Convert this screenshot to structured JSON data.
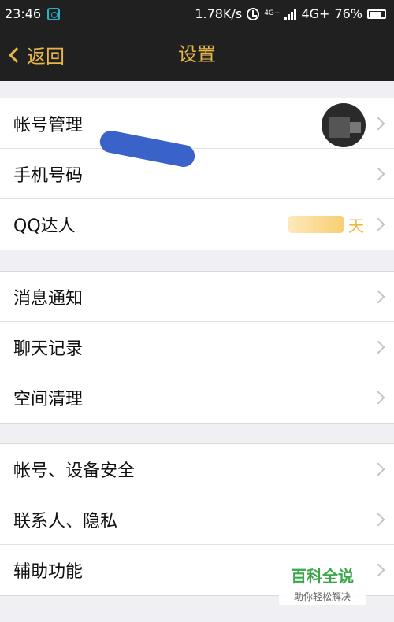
{
  "status_bar": {
    "time": "23:46",
    "speed": "1.78K/s",
    "net_small": "4G+",
    "network": "4G+",
    "battery": "76%",
    "icons": [
      "sim-icon",
      "alarm-icon",
      "signal-icon",
      "battery-icon"
    ]
  },
  "nav": {
    "back_label": "返回",
    "title": "设置"
  },
  "groups": [
    [
      {
        "label": "帐号管理"
      },
      {
        "label": "手机号码"
      },
      {
        "label": "QQ达人",
        "value_suffix": "天"
      }
    ],
    [
      {
        "label": "消息通知"
      },
      {
        "label": "聊天记录"
      },
      {
        "label": "空间清理"
      }
    ],
    [
      {
        "label": "帐号、设备安全"
      },
      {
        "label": "联系人、隐私"
      },
      {
        "label": "辅助功能"
      }
    ]
  ],
  "watermark": {
    "title": "百科全说",
    "subtitle": "助你轻松解决"
  },
  "colors": {
    "accent": "#e8b54a",
    "bar": "#202020",
    "background": "#efeff4"
  }
}
